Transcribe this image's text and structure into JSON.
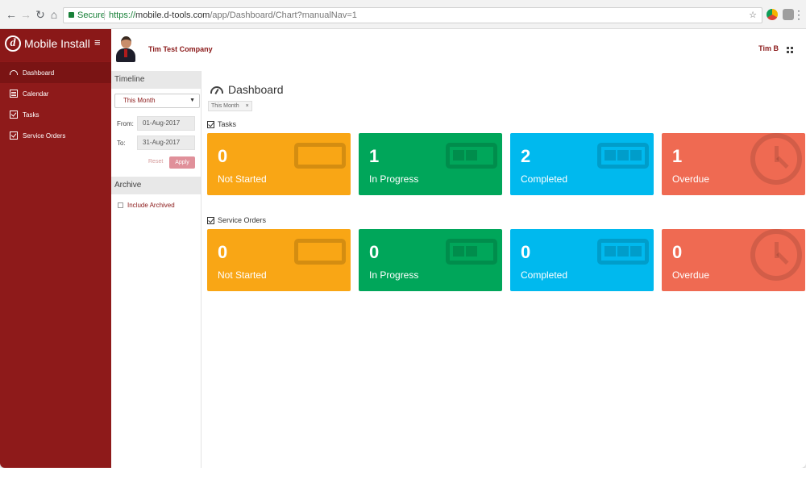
{
  "browser": {
    "secure_label": "Secure",
    "url_scheme": "https://",
    "url_host": "mobile.d-tools.com",
    "url_path": "/app/Dashboard/Chart?manualNav=1"
  },
  "sidebar": {
    "brand_logo": "d",
    "brand_title": "Mobile Install",
    "menu_icon": "≡",
    "items": [
      {
        "label": "Dashboard",
        "icon": "gauge-icon"
      },
      {
        "label": "Calendar",
        "icon": "calendar-icon"
      },
      {
        "label": "Tasks",
        "icon": "checkbox-icon"
      },
      {
        "label": "Service Orders",
        "icon": "checkbox-icon"
      }
    ]
  },
  "header": {
    "company": "Tim Test Company",
    "user": "Tim B"
  },
  "filters": {
    "timeline_title": "Timeline",
    "timeline_selected": "This Month",
    "from_label": "From:",
    "from_value": "01-Aug-2017",
    "to_label": "To:",
    "to_value": "31-Aug-2017",
    "reset_label": "Reset",
    "apply_label": "Apply",
    "archive_title": "Archive",
    "include_archived_label": "Include Archived"
  },
  "main": {
    "title": "Dashboard",
    "filter_chip": "This Month",
    "chip_close": "×",
    "tasks": {
      "section_label": "Tasks",
      "cards": [
        {
          "count": "0",
          "label": "Not Started",
          "color": "#f9a615"
        },
        {
          "count": "1",
          "label": "In Progress",
          "color": "#00a65a"
        },
        {
          "count": "2",
          "label": "Completed",
          "color": "#00b9ee"
        },
        {
          "count": "1",
          "label": "Overdue",
          "color": "#ef6a52"
        }
      ]
    },
    "service_orders": {
      "section_label": "Service Orders",
      "cards": [
        {
          "count": "0",
          "label": "Not Started",
          "color": "#f9a615"
        },
        {
          "count": "0",
          "label": "In Progress",
          "color": "#00a65a"
        },
        {
          "count": "0",
          "label": "Completed",
          "color": "#00b9ee"
        },
        {
          "count": "0",
          "label": "Overdue",
          "color": "#ef6a52"
        }
      ]
    }
  }
}
